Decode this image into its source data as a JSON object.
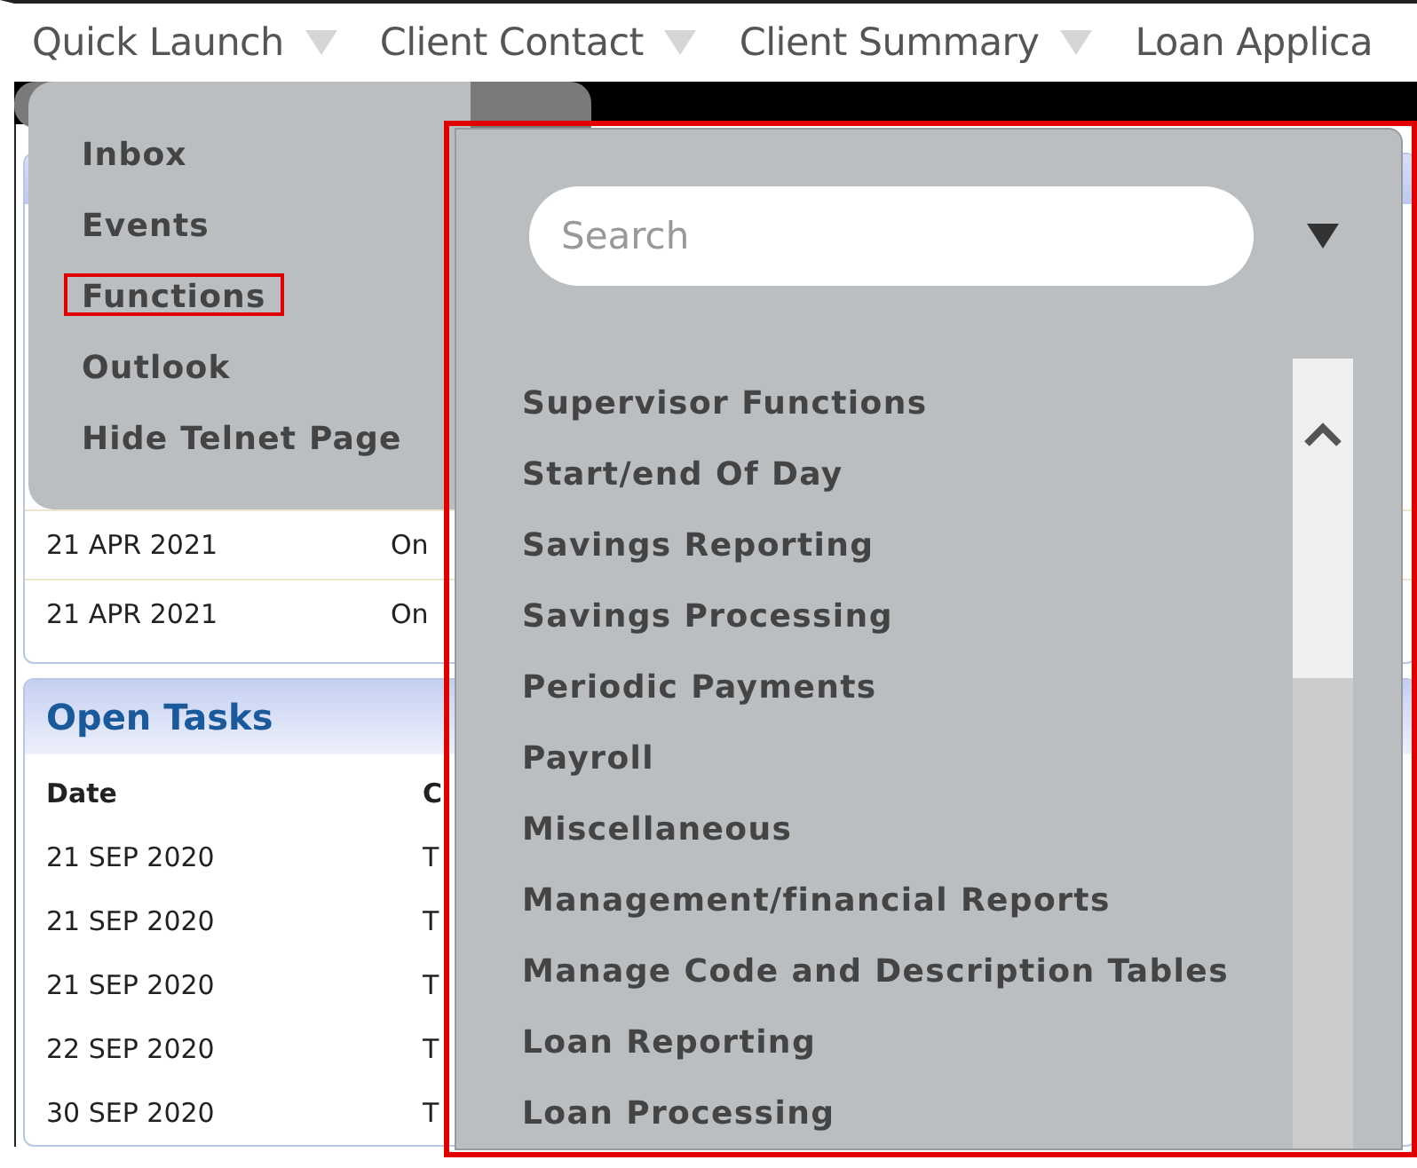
{
  "nav": [
    {
      "label": "Quick Launch",
      "arrow": true
    },
    {
      "label": "Client Contact",
      "arrow": true
    },
    {
      "label": "Client Summary",
      "arrow": true
    },
    {
      "label": "Loan Applica",
      "arrow": false
    }
  ],
  "events_panel": {
    "rows": [
      {
        "date": "21 APR 2021",
        "column_2": "On"
      },
      {
        "date": "21 APR 2021",
        "column_2": "On"
      }
    ]
  },
  "open_tasks": {
    "title": "Open Tasks",
    "columns": [
      "Date",
      "C"
    ],
    "rows": [
      {
        "date": "21 SEP 2020",
        "column_2": "T"
      },
      {
        "date": "21 SEP 2020",
        "column_2": "T"
      },
      {
        "date": "21 SEP 2020",
        "column_2": "T"
      },
      {
        "date": "22 SEP 2020",
        "column_2": "T"
      },
      {
        "date": "30 SEP 2020",
        "column_2": "T"
      }
    ]
  },
  "menu": {
    "items": [
      {
        "label": "Inbox",
        "selected": false
      },
      {
        "label": "Events",
        "selected": false
      },
      {
        "label": "Functions",
        "selected": true
      },
      {
        "label": "Outlook",
        "selected": false
      },
      {
        "label": "Hide Telnet Page",
        "selected": false
      }
    ]
  },
  "submenu": {
    "search": {
      "placeholder": "Search"
    },
    "items": [
      "Supervisor Functions",
      "Start/end Of Day",
      "Savings Reporting",
      "Savings Processing",
      "Periodic Payments",
      "Payroll",
      "Miscellaneous",
      "Management/financial Reports",
      "Manage Code and Description Tables",
      "Loan Reporting",
      "Loan Processing"
    ]
  }
}
